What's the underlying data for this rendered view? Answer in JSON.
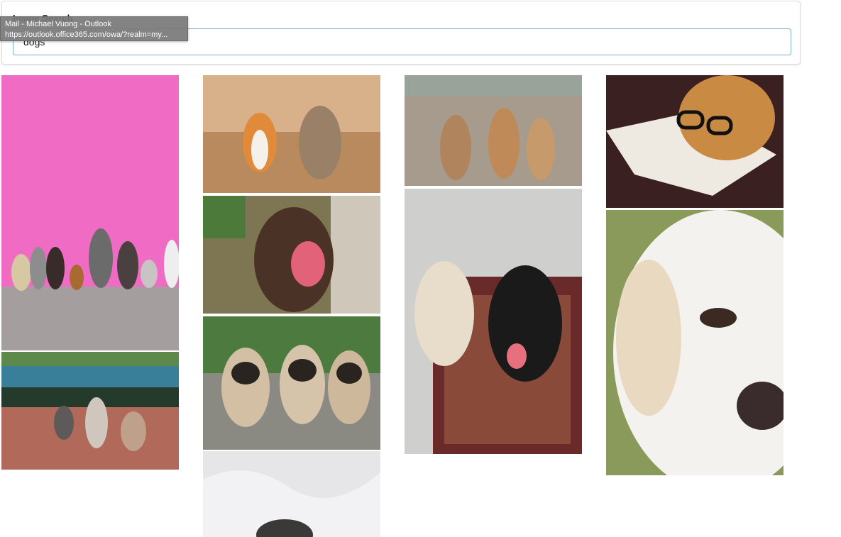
{
  "search": {
    "label": "Image Search",
    "value": "dogs"
  },
  "tooltip": {
    "title": "Mail - Michael Vuong - Outlook",
    "url": "https://outlook.office365.com/owa/?realm=my..."
  },
  "icons": {
    "photo": "image-icon"
  },
  "colors": {
    "input_border": "#7fb0d2",
    "pink_wall": "#f06cc4"
  }
}
